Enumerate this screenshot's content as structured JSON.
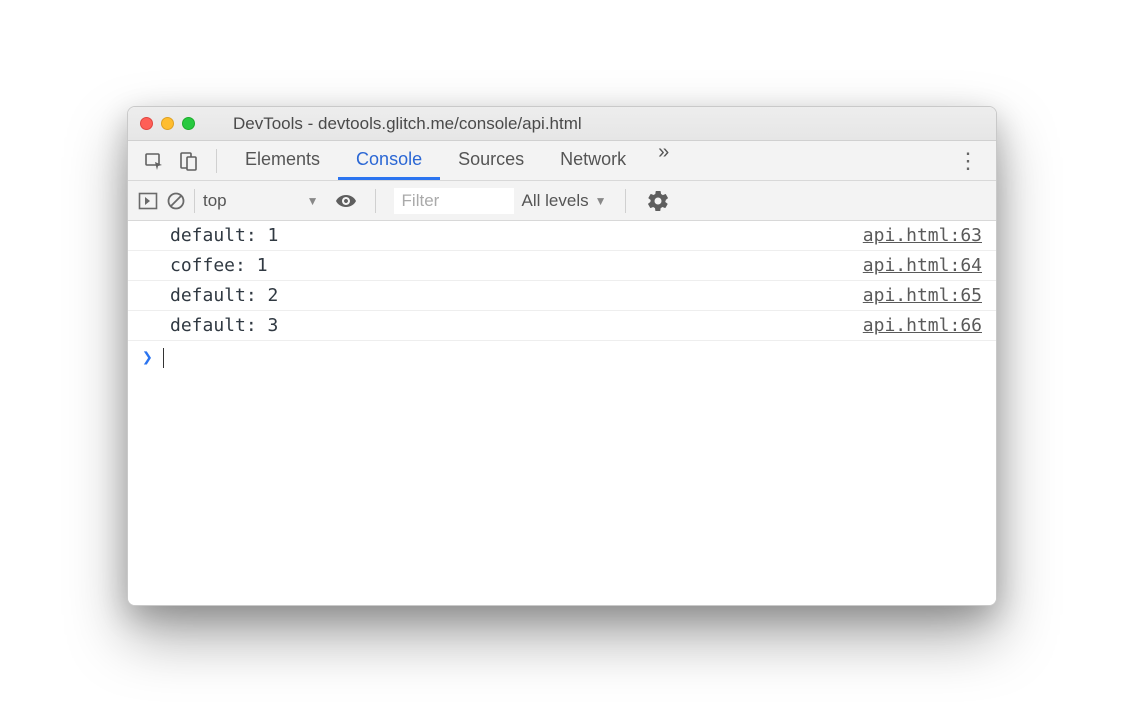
{
  "window": {
    "title": "DevTools - devtools.glitch.me/console/api.html"
  },
  "tabs": {
    "items": [
      "Elements",
      "Console",
      "Sources",
      "Network"
    ],
    "active_index": 1,
    "more_glyph": "»"
  },
  "console_toolbar": {
    "context": "top",
    "filter_placeholder": "Filter",
    "levels_label": "All levels"
  },
  "console": {
    "rows": [
      {
        "message": "default: 1",
        "source": "api.html:63"
      },
      {
        "message": "coffee: 1",
        "source": "api.html:64"
      },
      {
        "message": "default: 2",
        "source": "api.html:65"
      },
      {
        "message": "default: 3",
        "source": "api.html:66"
      }
    ],
    "prompt_glyph": "❯"
  }
}
